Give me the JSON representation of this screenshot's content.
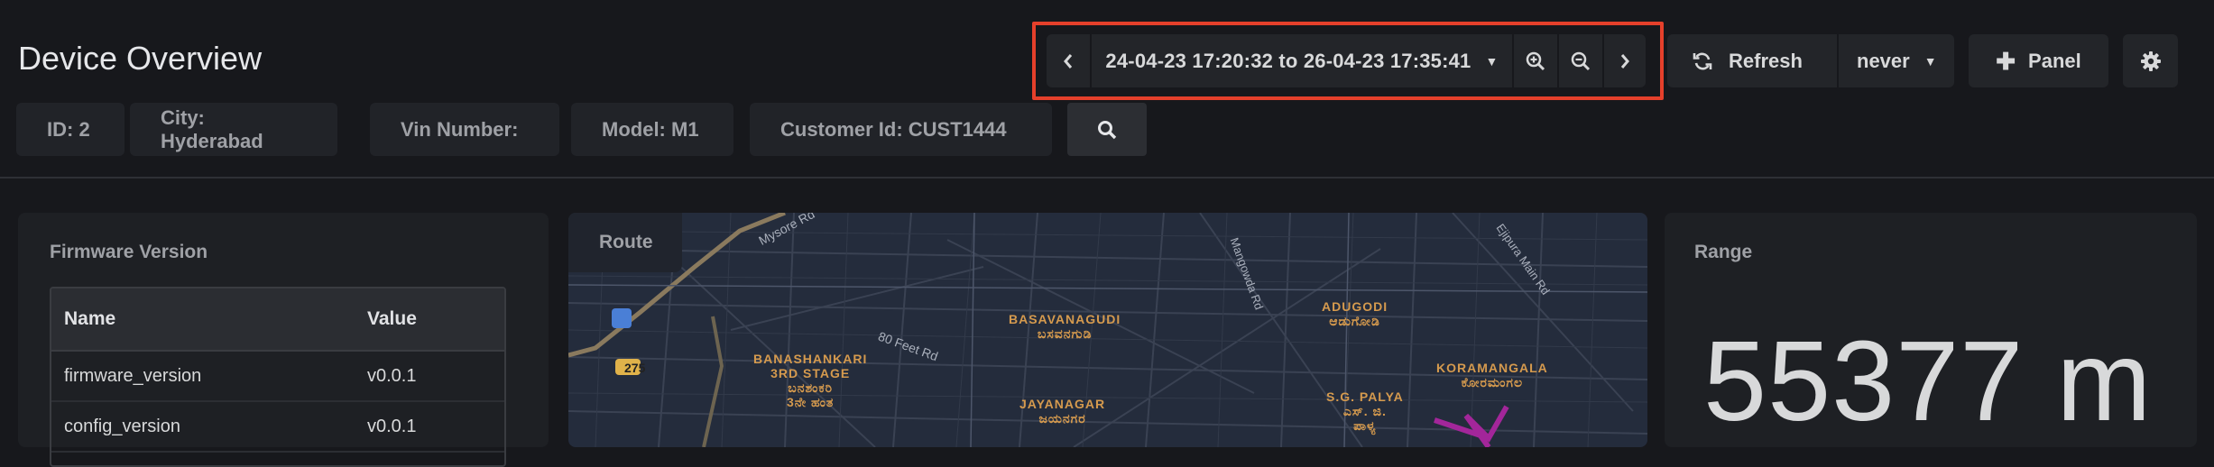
{
  "page": {
    "title": "Device Overview"
  },
  "toolbar": {
    "time_range": "24-04-23 17:20:32 to 26-04-23 17:35:41",
    "refresh_label": "Refresh",
    "refresh_interval": "never",
    "add_panel_label": "Panel"
  },
  "filters": [
    "ID: 2",
    "City: Hyderabad",
    "Vin Number:",
    "Model: M1",
    "Customer Id: CUST1444"
  ],
  "firmware_panel": {
    "title": "Firmware Version",
    "columns": [
      "Name",
      "Value"
    ],
    "rows": [
      [
        "firmware_version",
        "v0.0.1"
      ],
      [
        "config_version",
        "v0.0.1"
      ]
    ]
  },
  "route_panel": {
    "title": "Route",
    "map_labels": {
      "mysore_rd": "Mysore Rd",
      "feet_rd": "80 Feet Rd",
      "mangowda": "Mangowda Rd",
      "ejipura": "Ejipura Main Rd",
      "highway": "275",
      "basava_en": "BASAVANAGUDI",
      "basava_kn": "ಬಸವನಗುಡಿ",
      "adugodi_en": "ADUGODI",
      "adugodi_kn": "ಆಡುಗೋಡಿ",
      "bsk_1": "BANASHANKARI",
      "bsk_2": "3RD STAGE",
      "bsk_kn1": "ಬನಶಂಕರಿ",
      "bsk_kn2": "3ನೇ ಹಂತ",
      "jaya_en": "JAYANAGAR",
      "jaya_kn": "ಜಯನಗರ",
      "sgpalya_en": "S.G. PALYA",
      "sgpalya_kn1": "ಎಸ್. ಜಿ.",
      "sgpalya_kn2": "ಪಾಳ್ಯ",
      "kora_en": "KORAMANGALA",
      "kora_kn": "ಕೋರಮಂಗಲ"
    }
  },
  "range_panel": {
    "title": "Range",
    "value": "55377 m"
  },
  "colors": {
    "accent_highlight": "#e5402b",
    "route": "#a3269a",
    "map_label": "#d59a4e"
  }
}
